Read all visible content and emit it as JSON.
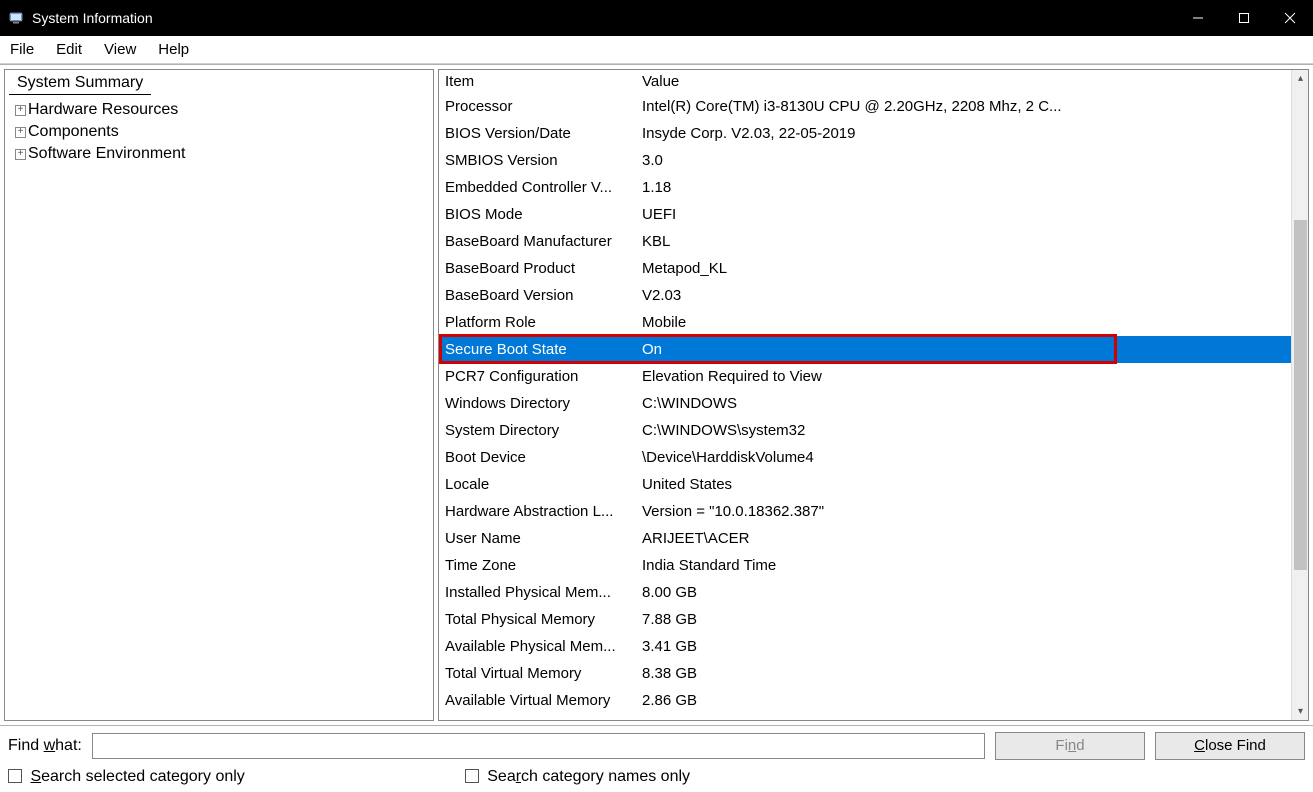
{
  "window": {
    "title": "System Information"
  },
  "menu": {
    "items": [
      "File",
      "Edit",
      "View",
      "Help"
    ]
  },
  "tree": {
    "header": "System Summary",
    "items": [
      {
        "label": "Hardware Resources"
      },
      {
        "label": "Components"
      },
      {
        "label": "Software Environment"
      }
    ]
  },
  "table": {
    "headers": {
      "item": "Item",
      "value": "Value"
    },
    "rows": [
      {
        "item": "Processor",
        "value": "Intel(R) Core(TM) i3-8130U CPU @ 2.20GHz, 2208 Mhz, 2 C..."
      },
      {
        "item": "BIOS Version/Date",
        "value": "Insyde Corp. V2.03, 22-05-2019"
      },
      {
        "item": "SMBIOS Version",
        "value": "3.0"
      },
      {
        "item": "Embedded Controller V...",
        "value": "1.18"
      },
      {
        "item": "BIOS Mode",
        "value": "UEFI"
      },
      {
        "item": "BaseBoard Manufacturer",
        "value": "KBL"
      },
      {
        "item": "BaseBoard Product",
        "value": "Metapod_KL"
      },
      {
        "item": "BaseBoard Version",
        "value": "V2.03"
      },
      {
        "item": "Platform Role",
        "value": "Mobile"
      },
      {
        "item": "Secure Boot State",
        "value": "On",
        "selected": true,
        "highlighted": true
      },
      {
        "item": "PCR7 Configuration",
        "value": "Elevation Required to View"
      },
      {
        "item": "Windows Directory",
        "value": "C:\\WINDOWS"
      },
      {
        "item": "System Directory",
        "value": "C:\\WINDOWS\\system32"
      },
      {
        "item": "Boot Device",
        "value": "\\Device\\HarddiskVolume4"
      },
      {
        "item": "Locale",
        "value": "United States"
      },
      {
        "item": "Hardware Abstraction L...",
        "value": "Version = \"10.0.18362.387\""
      },
      {
        "item": "User Name",
        "value": "ARIJEET\\ACER"
      },
      {
        "item": "Time Zone",
        "value": "India Standard Time"
      },
      {
        "item": "Installed Physical Mem...",
        "value": "8.00 GB"
      },
      {
        "item": "Total Physical Memory",
        "value": "7.88 GB"
      },
      {
        "item": "Available Physical Mem...",
        "value": "3.41 GB"
      },
      {
        "item": "Total Virtual Memory",
        "value": "8.38 GB"
      },
      {
        "item": "Available Virtual Memory",
        "value": "2.86 GB"
      }
    ]
  },
  "search": {
    "label_prefix": "Find ",
    "label_underline": "w",
    "label_suffix": "hat:",
    "find_button_prefix": "Fi",
    "find_button_underline": "n",
    "find_button_suffix": "d",
    "close_button_prefix": "",
    "close_button_underline": "C",
    "close_button_suffix": "lose Find",
    "check1_prefix": "",
    "check1_underline": "S",
    "check1_suffix": "earch selected category only",
    "check2_prefix": "Sea",
    "check2_underline": "r",
    "check2_suffix": "ch category names only"
  }
}
